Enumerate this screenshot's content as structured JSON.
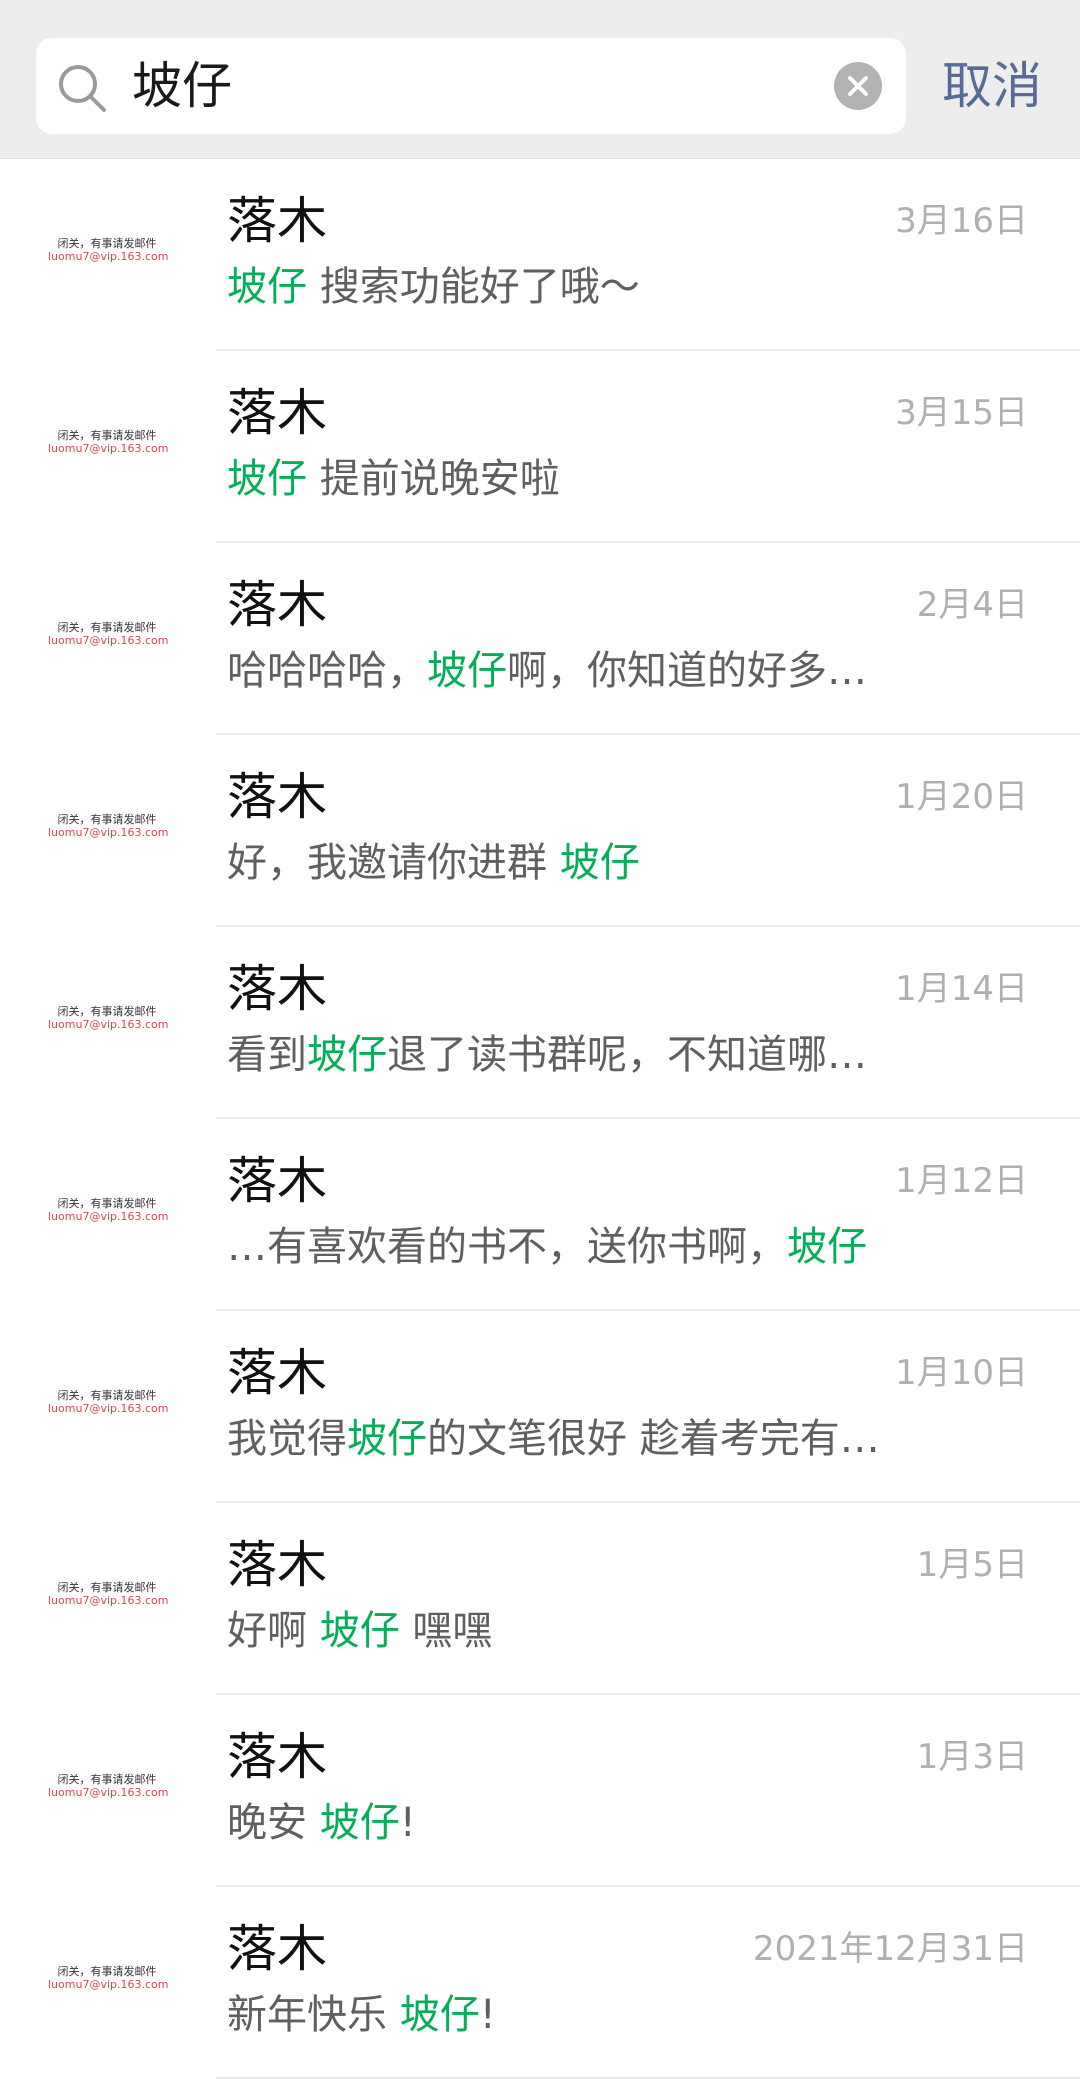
{
  "search": {
    "query": "坡仔",
    "cancel_label": "取消"
  },
  "avatar": {
    "line1": "闭关，有事请发邮件",
    "line2": "luomu7@vip.163.com"
  },
  "results": [
    {
      "name": "落木",
      "date": "3月16日",
      "before": "",
      "highlight": "坡仔",
      "after": " 搜索功能好了哦～"
    },
    {
      "name": "落木",
      "date": "3月15日",
      "before": "",
      "highlight": "坡仔",
      "after": " 提前说晚安啦"
    },
    {
      "name": "落木",
      "date": "2月4日",
      "before": "哈哈哈哈，",
      "highlight": "坡仔",
      "after": "啊，你知道的好多…"
    },
    {
      "name": "落木",
      "date": "1月20日",
      "before": "好，我邀请你进群  ",
      "highlight": "坡仔",
      "after": ""
    },
    {
      "name": "落木",
      "date": "1月14日",
      "before": "看到",
      "highlight": "坡仔",
      "after": "退了读书群呢，不知道哪…"
    },
    {
      "name": "落木",
      "date": "1月12日",
      "before": "…有喜欢看的书不，送你书啊，",
      "highlight": "坡仔",
      "after": ""
    },
    {
      "name": "落木",
      "date": "1月10日",
      "before": "我觉得",
      "highlight": "坡仔",
      "after": "的文笔很好  趁着考完有…"
    },
    {
      "name": "落木",
      "date": "1月5日",
      "before": "好啊 ",
      "highlight": "坡仔",
      "after": "  嘿嘿"
    },
    {
      "name": "落木",
      "date": "1月3日",
      "before": "晚安 ",
      "highlight": "坡仔",
      "after": "!"
    },
    {
      "name": "落木",
      "date": "2021年12月31日",
      "before": "新年快乐 ",
      "highlight": "坡仔",
      "after": "!"
    }
  ],
  "colors": {
    "highlight": "#06ae56",
    "cancel": "#576b95",
    "background_header": "#ededed"
  }
}
